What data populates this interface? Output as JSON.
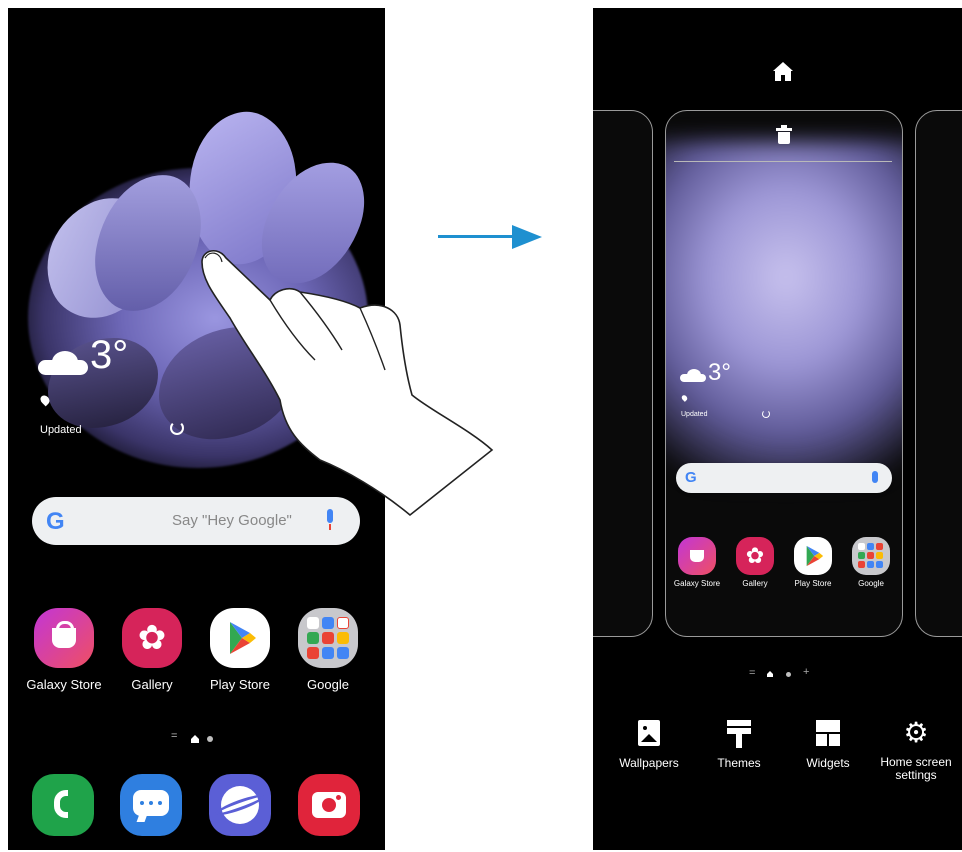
{
  "left_screen": {
    "weather": {
      "temperature": "3°",
      "updated_label": "Updated"
    },
    "search": {
      "placeholder": "Say \"Hey Google\""
    },
    "apps": [
      {
        "label": "Galaxy Store",
        "icon": "galaxy-store-icon"
      },
      {
        "label": "Gallery",
        "icon": "gallery-icon"
      },
      {
        "label": "Play Store",
        "icon": "play-store-icon"
      },
      {
        "label": "Google",
        "icon": "google-folder-icon"
      }
    ],
    "dock": [
      "phone-icon",
      "messages-icon",
      "internet-icon",
      "camera-icon"
    ],
    "page_indicator": "="
  },
  "right_screen": {
    "card": {
      "weather": {
        "temperature": "3°",
        "updated_label": "Updated"
      },
      "apps": [
        {
          "label": "Galaxy Store"
        },
        {
          "label": "Gallery"
        },
        {
          "label": "Play Store"
        },
        {
          "label": "Google"
        }
      ]
    },
    "page_indicator": {
      "left": "=",
      "add": "+"
    },
    "toolbar": [
      {
        "label": "Wallpapers",
        "icon": "wallpapers-icon"
      },
      {
        "label": "Themes",
        "icon": "themes-icon"
      },
      {
        "label": "Widgets",
        "icon": "widgets-icon"
      },
      {
        "label": "Home screen\nsettings",
        "icon": "settings-icon"
      }
    ]
  },
  "colors": {
    "arrow": "#1e90d0",
    "galaxy_store": "#d93a8f",
    "gallery": "#d6245a",
    "phone": "#1fa34a",
    "messages": "#2f7fe0",
    "internet": "#5b5fd6",
    "camera": "#e0243b"
  }
}
